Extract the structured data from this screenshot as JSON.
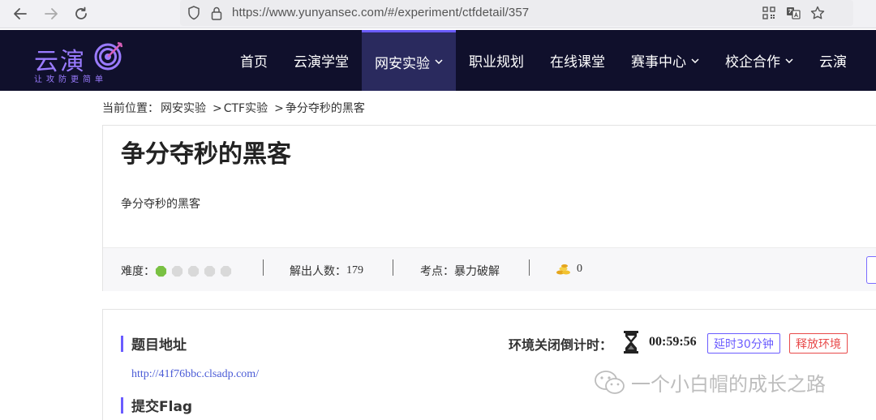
{
  "browser": {
    "url": "https://www.yunyansec.com/#/experiment/ctfdetail/357"
  },
  "header": {
    "logo_title": "云演",
    "logo_slogan": "让攻防更简单",
    "nav": [
      {
        "label": "首页"
      },
      {
        "label": "云演学堂"
      },
      {
        "label": "网安实验",
        "active": true,
        "dropdown": true
      },
      {
        "label": "职业规划"
      },
      {
        "label": "在线课堂"
      },
      {
        "label": "赛事中心",
        "dropdown": true
      },
      {
        "label": "校企合作",
        "dropdown": true
      },
      {
        "label": "云演"
      }
    ]
  },
  "breadcrumb": {
    "prefix": "当前位置：",
    "items": [
      "网安实验",
      "CTF实验",
      "争分夺秒的黑客"
    ],
    "separator": ">"
  },
  "challenge": {
    "title": "争分夺秒的黑客",
    "description": "争分夺秒的黑客",
    "difficulty_label": "难度：",
    "difficulty_level": 1,
    "difficulty_max": 5,
    "solved_label": "解出人数：",
    "solved_count": "179",
    "topic_label": "考点：",
    "topic_value": "暴力破解",
    "coins": "0"
  },
  "env": {
    "section_title": "题目地址",
    "url": "http://41f76bbc.clsadp.com/",
    "timer_label": "环境关闭倒计时：",
    "timer_value": "00:59:56",
    "extend_label": "延时30分钟",
    "release_label": "释放环境",
    "flag_title": "提交Flag"
  },
  "watermark": {
    "text": "一个小白帽的成长之路"
  },
  "colors": {
    "nav_bg": "#10102c",
    "accent": "#6b5cff",
    "danger": "#e84a4a",
    "difficulty_on": "#7ac143",
    "difficulty_off": "#d9d9d9"
  }
}
